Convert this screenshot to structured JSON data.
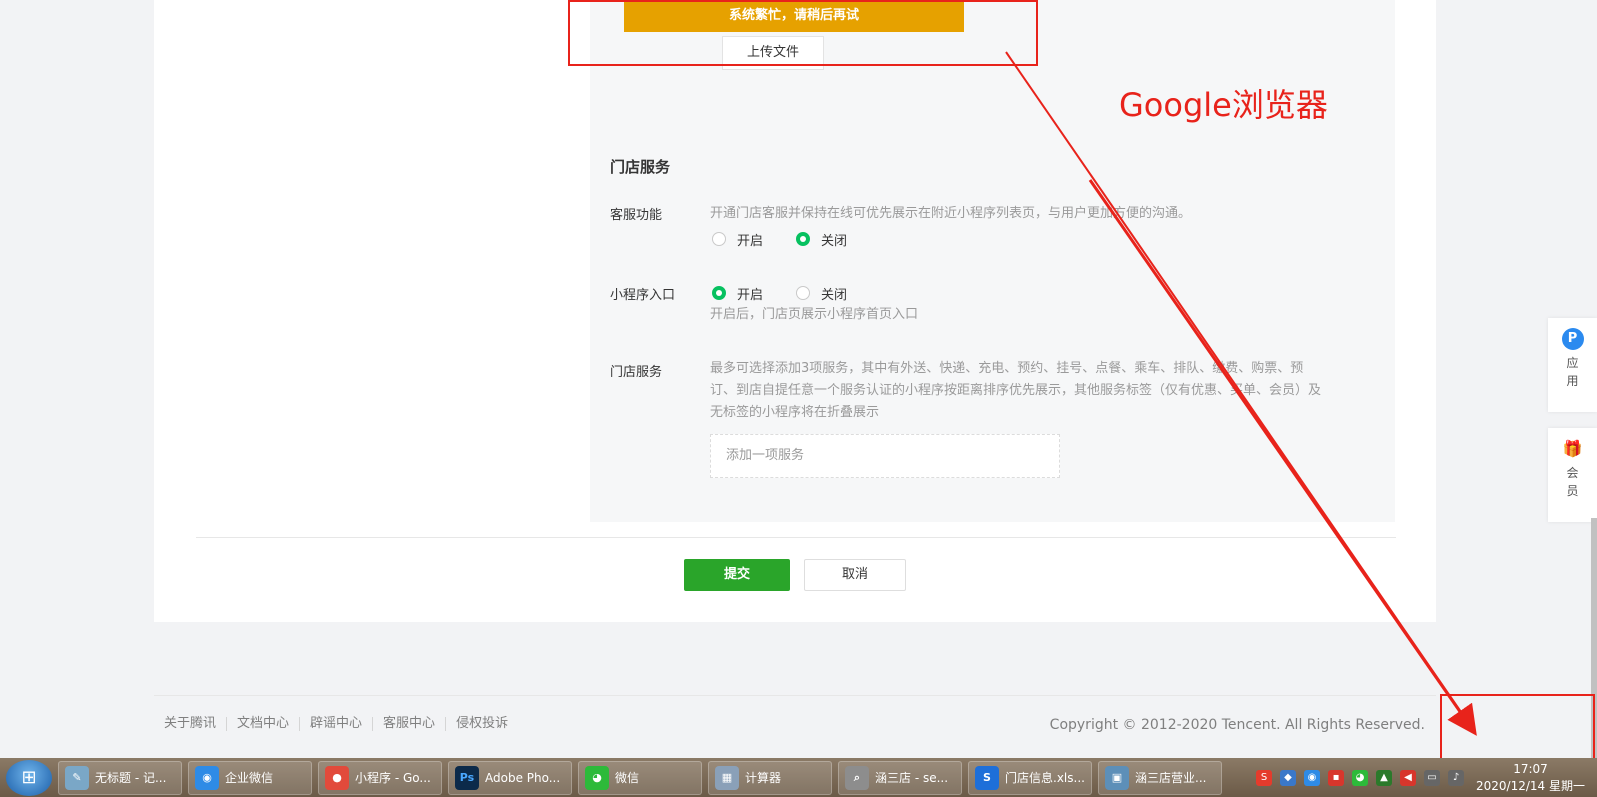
{
  "alert": {
    "text": "系统繁忙，请稍后再试"
  },
  "upload": {
    "label": "上传文件"
  },
  "store_service": {
    "title": "门店服务",
    "customer_service": {
      "label": "客服功能",
      "desc": "开通门店客服并保持在线可优先展示在附近小程序列表页，与用户更加方便的沟通。",
      "options": [
        "开启",
        "关闭"
      ],
      "selected": "关闭"
    },
    "mini_entry": {
      "label": "小程序入口",
      "options": [
        "开启",
        "关闭"
      ],
      "selected": "开启",
      "desc": "开启后，门店页展示小程序首页入口"
    },
    "services": {
      "label": "门店服务",
      "desc_lines": [
        "最多可选择添加3项服务，其中有外送、快递、充电、预约、挂号、点餐、乘车、排队、缴费、购票、预",
        "订、到店自提任意一个服务认证的小程序按距离排序优先展示，其他服务标签（仅有优惠、买单、会员）及",
        "无标签的小程序将在折叠展示"
      ],
      "add_placeholder": "添加一项服务"
    }
  },
  "actions": {
    "submit": "提交",
    "cancel": "取消"
  },
  "footer": {
    "links": [
      "关于腾讯",
      "文档中心",
      "辟谣中心",
      "客服中心",
      "侵权投诉"
    ],
    "copyright": "Copyright © 2012-2020 Tencent. All Rights Reserved."
  },
  "side_widgets": [
    {
      "icon": "p-icon",
      "glyph": "P",
      "label": "应用",
      "color": "#2b8aef"
    },
    {
      "icon": "gift-icon",
      "glyph": "🎁",
      "label": "会员",
      "color": "#ffffff"
    }
  ],
  "annotation": {
    "text": "Google浏览器",
    "color": "#e8231b"
  },
  "taskbar": {
    "items": [
      {
        "label": "无标题 - 记...",
        "glyph": "✎",
        "color": "#7aa7c7"
      },
      {
        "label": "企业微信",
        "glyph": "◉",
        "color": "#2e8be6"
      },
      {
        "label": "小程序 - Go...",
        "glyph": "●",
        "color": "#e24a3b"
      },
      {
        "label": "Adobe Pho...",
        "glyph": "Ps",
        "color": "#0c2a4a"
      },
      {
        "label": "微信",
        "glyph": "◕",
        "color": "#2dba3a"
      },
      {
        "label": "计算器",
        "glyph": "▦",
        "color": "#8aa0b8"
      },
      {
        "label": "涵三店 - se...",
        "glyph": "⌕",
        "color": "#8d8d8d"
      },
      {
        "label": "门店信息.xls...",
        "glyph": "S",
        "color": "#1e6fd9"
      },
      {
        "label": "涵三店营业...",
        "glyph": "▣",
        "color": "#5d8fb8"
      }
    ],
    "clock_time": "17:07",
    "clock_date": "2020/12/14 星期一"
  }
}
